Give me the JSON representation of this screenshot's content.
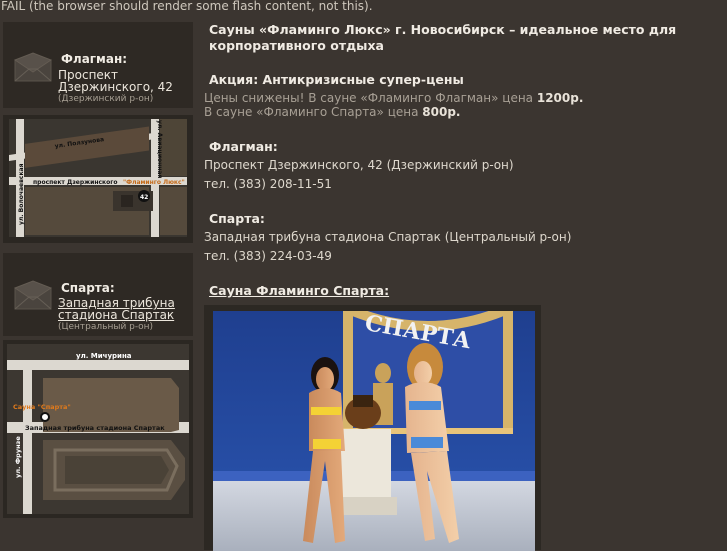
{
  "flash_fail": "FAIL (the browser should render some flash content, not this).",
  "flagman_box": {
    "title": "Флагман:",
    "street_line1": "Проспект",
    "street_line2": "Дзержинского, 42",
    "district": "(Дзержинский р-он)"
  },
  "flagman_map": {
    "street_top": "ул. Ползунова",
    "street_vertical_left": "ул. Волочаевская",
    "street_vertical_right": "ул. Авиационная",
    "street_main": "проспект Дзержинского",
    "place": "\"Фламинго Люкс\"",
    "building": "42"
  },
  "sparta_box": {
    "title": "Спарта:",
    "street_line1": "Западная трибуна",
    "street_line2": "стадиона Спартак",
    "district": "(Центральный р-он)"
  },
  "sparta_map": {
    "street_top": "ул. Мичурина",
    "place": "Сауна \"Спарта\"",
    "street_main": "Западная трибуна стадиона Спартак",
    "street_vertical": "ул. Фрунзе"
  },
  "main": {
    "headline": "Сауны «Фламинго Люкс» г. Новосибирск – идеальное место для корпоративного отдыха",
    "promo_title": "Акция: Антикризисные супер-цены",
    "promo_line1_pre": "Цены снижены! В сауне «Фламинго Флагман» цена ",
    "promo_line1_price": "1200р.",
    "promo_line2_pre": "В сауне «Фламинго Спарта» цена ",
    "promo_line2_price": "800р.",
    "flagman_title": "Флагман:",
    "flagman_address": "Проспект Дзержинского, 42 (Дзержинский р-он)",
    "flagman_phone": "тел. (383) 208-11-51",
    "sparta_title": "Спарта:",
    "sparta_address": "Западная трибуна стадиона Спартак (Центральный р-он)",
    "sparta_phone": "тел. (383) 224-03-49",
    "sparta_link": "Сауна Фламинго Спарта:",
    "photo_sign": "СПАРТА"
  }
}
